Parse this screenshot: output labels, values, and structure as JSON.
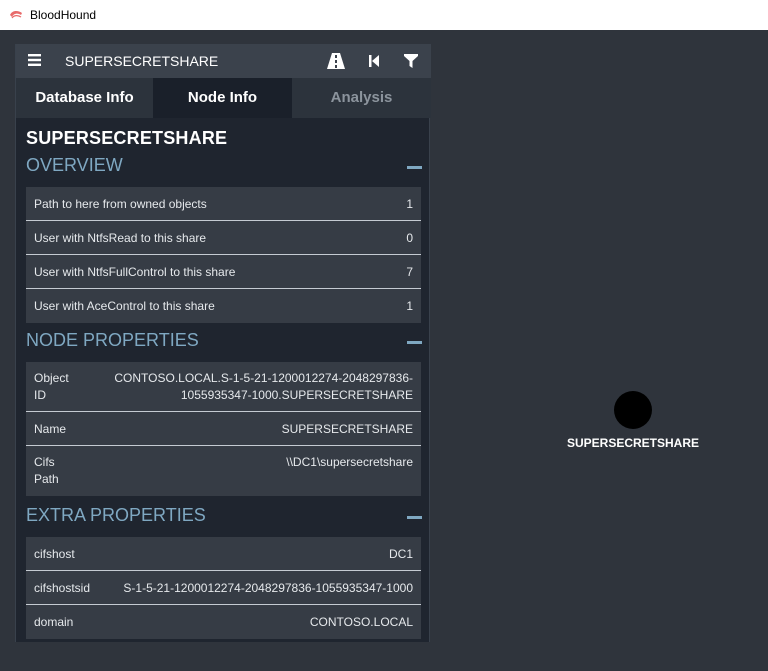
{
  "window": {
    "title": "BloodHound"
  },
  "header": {
    "title": "SUPERSECRETSHARE"
  },
  "tabs": [
    {
      "label": "Database Info"
    },
    {
      "label": "Node Info"
    },
    {
      "label": "Analysis"
    }
  ],
  "node": {
    "title": "SUPERSECRETSHARE"
  },
  "overview": {
    "title": "OVERVIEW",
    "rows": [
      {
        "label": "Path to here from owned objects",
        "value": "1"
      },
      {
        "label": "User with NtfsRead to this share",
        "value": "0"
      },
      {
        "label": "User with NtfsFullControl to this share",
        "value": "7"
      },
      {
        "label": "User with AceControl to this share",
        "value": "1"
      }
    ]
  },
  "node_properties": {
    "title": "NODE PROPERTIES",
    "rows": [
      {
        "label": "Object ID",
        "value": "CONTOSO.LOCAL.S-1-5-21-1200012274-2048297836-1055935347-1000.SUPERSECRETSHARE"
      },
      {
        "label": "Name",
        "value": "SUPERSECRETSHARE"
      },
      {
        "label": "Cifs Path",
        "value": "\\\\DC1\\supersecretshare"
      }
    ]
  },
  "extra_properties": {
    "title": "EXTRA PROPERTIES",
    "rows": [
      {
        "label": "cifshost",
        "value": "DC1"
      },
      {
        "label": "cifshostsid",
        "value": "S-1-5-21-1200012274-2048297836-1055935347-1000"
      },
      {
        "label": "domain",
        "value": "CONTOSO.LOCAL"
      }
    ]
  },
  "graph": {
    "node_label": "SUPERSECRETSHARE"
  },
  "colors": {
    "accent": "#7fa8c2",
    "panel": "#1f252f",
    "canvas": "#2f343c"
  }
}
